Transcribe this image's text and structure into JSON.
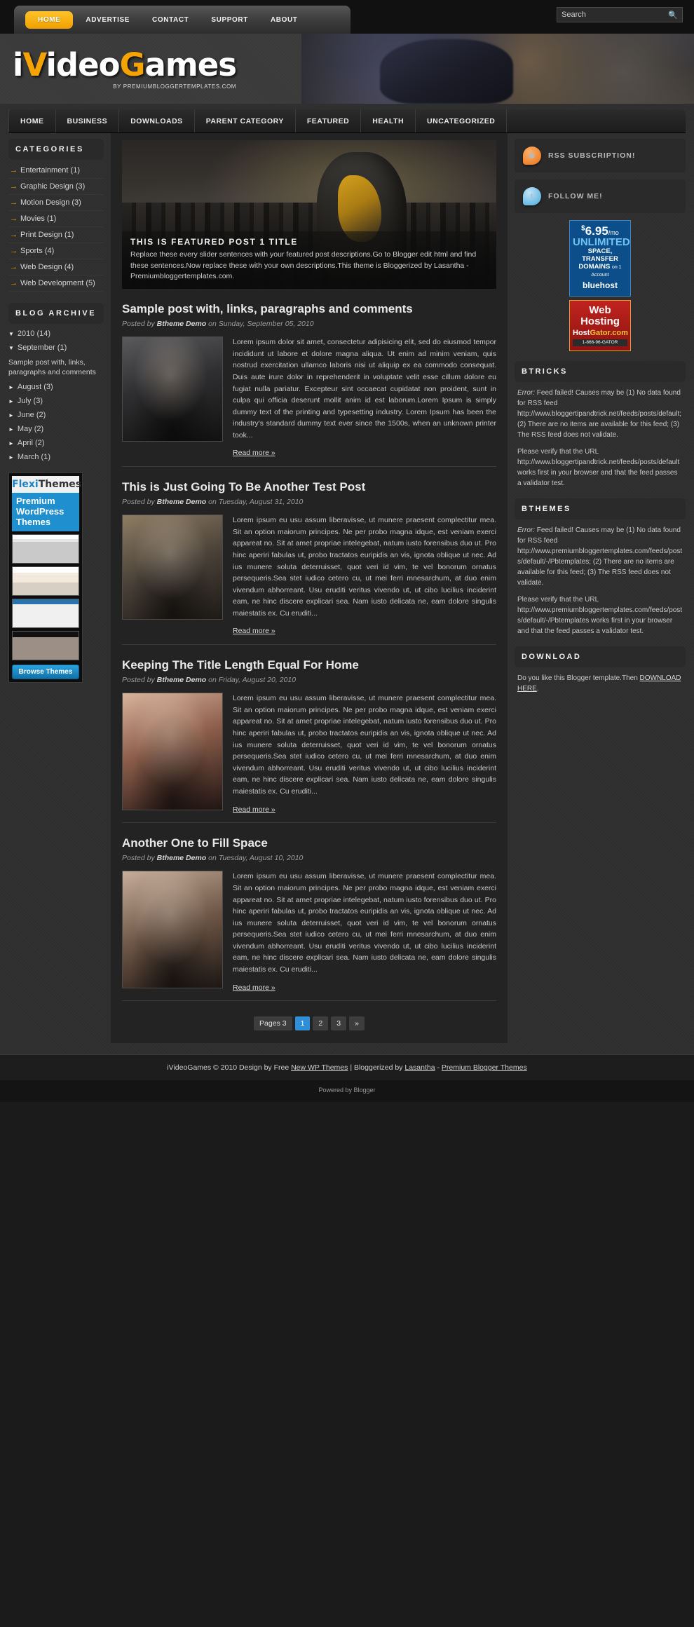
{
  "topnav": {
    "items": [
      {
        "label": "HOME",
        "active": true
      },
      {
        "label": "ADVERTISE",
        "active": false
      },
      {
        "label": "CONTACT",
        "active": false
      },
      {
        "label": "SUPPORT",
        "active": false
      },
      {
        "label": "ABOUT",
        "active": false
      }
    ]
  },
  "search": {
    "placeholder": "Search",
    "value": ""
  },
  "brand": {
    "name_pre": "i",
    "name_v": "V",
    "name_mid": "ideo",
    "name_g": "G",
    "name_end": "ames",
    "tagline": "BY PREMIUMBLOGGERTEMPLATES.COM"
  },
  "mainnav": {
    "items": [
      "HOME",
      "BUSINESS",
      "DOWNLOADS",
      "PARENT CATEGORY",
      "FEATURED",
      "HEALTH",
      "UNCATEGORIZED"
    ]
  },
  "sidebar_left": {
    "categories_title": "CATEGORIES",
    "categories": [
      "Entertainment (1)",
      "Graphic Design (3)",
      "Motion Design (3)",
      "Movies (1)",
      "Print Design (1)",
      "Sports (4)",
      "Web Design (4)",
      "Web Development (5)"
    ],
    "archive_title": "BLOG ARCHIVE",
    "archive": [
      {
        "level": 1,
        "arrow": "▼",
        "label": "2010 (14)"
      },
      {
        "level": 2,
        "arrow": "▼",
        "label": "September (1)"
      },
      {
        "level": 3,
        "arrow": "",
        "label": "Sample post with, links, paragraphs and comments"
      },
      {
        "level": 2,
        "arrow": "►",
        "label": "August (3)"
      },
      {
        "level": 2,
        "arrow": "►",
        "label": "July (3)"
      },
      {
        "level": 2,
        "arrow": "►",
        "label": "June (2)"
      },
      {
        "level": 2,
        "arrow": "►",
        "label": "May (2)"
      },
      {
        "level": 2,
        "arrow": "►",
        "label": "April (2)"
      },
      {
        "level": 2,
        "arrow": "►",
        "label": "March (1)"
      }
    ],
    "flexithemes": {
      "logo_b": "Flexi",
      "logo_d": "Themes",
      "headline": "Premium WordPress Themes",
      "button": "Browse Themes"
    }
  },
  "slider": {
    "title": "THIS IS FEATURED POST 1 TITLE",
    "description": "Replace these every slider sentences with your featured post descriptions.Go to Blogger edit html and find these sentences.Now replace these with your own descriptions.This theme is Bloggerized by Lasantha - Premiumbloggertemplates.com."
  },
  "posts": [
    {
      "title": "Sample post with, links, paragraphs and comments",
      "meta_pre": "Posted by ",
      "meta_author": "Btheme Demo",
      "meta_post": " on Sunday, September 05, 2010",
      "body": "Lorem ipsum dolor sit amet, consectetur adipisicing elit, sed do eiusmod tempor incididunt ut labore et dolore magna aliqua. Ut enim ad minim veniam, quis nostrud exercitation ullamco laboris nisi ut aliquip ex ea commodo consequat. Duis aute irure dolor in reprehenderit in voluptate velit esse cillum dolore eu fugiat nulla pariatur. Excepteur sint occaecat cupidatat non proident, sunt in culpa qui officia deserunt mollit anim id est laborum.Lorem Ipsum is simply dummy text of the printing and typesetting industry. Lorem Ipsum has been the industry's standard dummy text ever since the 1500s, when an unknown printer took...",
      "readmore": "Read more »",
      "thumb": "t1"
    },
    {
      "title": "This is Just Going To Be Another Test Post",
      "meta_pre": "Posted by ",
      "meta_author": "Btheme Demo",
      "meta_post": " on Tuesday, August 31, 2010",
      "body": "Lorem ipsum eu usu assum liberavisse, ut munere praesent complectitur mea. Sit an option maiorum principes. Ne per probo magna idque, est veniam exerci appareat no. Sit at amet propriae intelegebat, natum iusto forensibus duo ut. Pro hinc aperiri fabulas ut, probo tractatos euripidis an vis, ignota oblique ut nec. Ad ius munere soluta deterruisset, quot veri id vim, te vel bonorum ornatus persequeris.Sea stet iudico cetero cu, ut mei ferri mnesarchum, at duo enim vivendum abhorreant. Usu eruditi veritus vivendo ut, ut cibo lucilius inciderint eam, ne hinc discere explicari sea. Nam iusto delicata ne, eam dolore singulis maiestatis ex. Cu eruditi...",
      "readmore": "Read more »",
      "thumb": "t2"
    },
    {
      "title": "Keeping The Title Length Equal For Home",
      "meta_pre": "Posted by ",
      "meta_author": "Btheme Demo",
      "meta_post": " on Friday, August 20, 2010",
      "body": "Lorem ipsum eu usu assum liberavisse, ut munere praesent complectitur mea. Sit an option maiorum principes. Ne per probo magna idque, est veniam exerci appareat no. Sit at amet propriae intelegebat, natum iusto forensibus duo ut. Pro hinc aperiri fabulas ut, probo tractatos euripidis an vis, ignota oblique ut nec. Ad ius munere soluta deterruisset, quot veri id vim, te vel bonorum ornatus persequeris.Sea stet iudico cetero cu, ut mei ferri mnesarchum, at duo enim vivendum abhorreant. Usu eruditi veritus vivendo ut, ut cibo lucilius inciderint eam, ne hinc discere explicari sea. Nam iusto delicata ne, eam dolore singulis maiestatis ex. Cu eruditi...",
      "readmore": "Read more »",
      "thumb": "t3"
    },
    {
      "title": "Another One to Fill Space",
      "meta_pre": "Posted by ",
      "meta_author": "Btheme Demo",
      "meta_post": " on Tuesday, August 10, 2010",
      "body": "Lorem ipsum eu usu assum liberavisse, ut munere praesent complectitur mea. Sit an option maiorum principes. Ne per probo magna idque, est veniam exerci appareat no. Sit at amet propriae intelegebat, natum iusto forensibus duo ut. Pro hinc aperiri fabulas ut, probo tractatos euripidis an vis, ignota oblique ut nec. Ad ius munere soluta deterruisset, quot veri id vim, te vel bonorum ornatus persequeris.Sea stet iudico cetero cu, ut mei ferri mnesarchum, at duo enim vivendum abhorreant. Usu eruditi veritus vivendo ut, ut cibo lucilius inciderint eam, ne hinc discere explicari sea. Nam iusto delicata ne, eam dolore singulis maiestatis ex. Cu eruditi...",
      "readmore": "Read more »",
      "thumb": "t4"
    }
  ],
  "pagination": {
    "label": "Pages 3",
    "pages": [
      "1",
      "2",
      "3",
      "»"
    ],
    "current": "1"
  },
  "sidebar_right": {
    "rss_label": "RSS SUBSCRIPTION!",
    "twitter_label": "FOLLOW ME!",
    "ad_bluehost": {
      "currency": "$",
      "price": "6.95",
      "per": "/mo",
      "unlimited": "UNLIMITED",
      "line2": "SPACE, TRANSFER",
      "line3": "DOMAINS",
      "line3_small": "on 1 Account",
      "brand": "bluehost"
    },
    "ad_hostgator": {
      "line1": "Web",
      "line2": "Hosting",
      "brand_a": "Host",
      "brand_b": "Gator",
      "brand_tail": ".com",
      "phone": "1-866-96-GATOR"
    },
    "widgets": [
      {
        "title": "BTRICKS",
        "error_label": "Error:",
        "para1": " Feed failed! Causes may be (1) No data found for RSS feed http://www.bloggertipandtrick.net/feeds/posts/default; (2) There are no items are available for this feed; (3) The RSS feed does not validate.",
        "para2": "Please verify that the URL http://www.bloggertipandtrick.net/feeds/posts/default works first in your browser and that the feed passes a validator test."
      },
      {
        "title": "BTHEMES",
        "error_label": "Error:",
        "para1": " Feed failed! Causes may be (1) No data found for RSS feed http://www.premiumbloggertemplates.com/feeds/posts/default/-/Pbtemplates; (2) There are no items are available for this feed; (3) The RSS feed does not validate.",
        "para2": "Please verify that the URL http://www.premiumbloggertemplates.com/feeds/posts/default/-/Pbtemplates works first in your browser and that the feed passes a validator test."
      }
    ],
    "download": {
      "title": "DOWNLOAD",
      "text_pre": "Do you like this Blogger template.Then ",
      "link": "DOWNLOAD HERE",
      "text_post": "."
    }
  },
  "footer": {
    "site": "iVideoGames",
    "copy": " © 2010 Design by Free ",
    "link1": "New WP Themes",
    "mid": " | Bloggerized by ",
    "link2": "Lasantha",
    "sep": " - ",
    "link3": "Premium Blogger Themes",
    "credit_pre": "Powered by ",
    "credit_link": "Blogger"
  }
}
